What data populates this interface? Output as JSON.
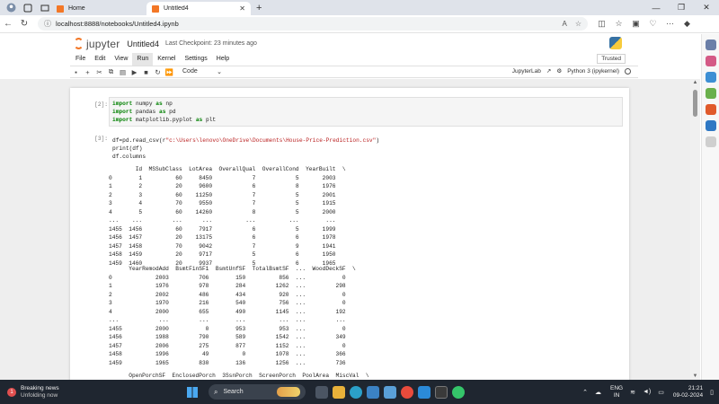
{
  "browser": {
    "tabs": [
      {
        "label": "Home",
        "active": false,
        "icon": "jupyter-favicon"
      },
      {
        "label": "Untitled4",
        "active": true,
        "icon": "jupyter-favicon"
      }
    ],
    "url": "localhost:8888/notebooks/Untitled4.ipynb"
  },
  "jupyter": {
    "logo_text": "jupyter",
    "notebook_name": "Untitled4",
    "checkpoint": "Last Checkpoint: 23 minutes ago",
    "menu": [
      "File",
      "Edit",
      "View",
      "Run",
      "Kernel",
      "Settings",
      "Help"
    ],
    "selected_menu": "Run",
    "trusted": "Trusted",
    "cell_type": "Code",
    "jupyterlab_link": "JupyterLab",
    "kernel": "Python 3 (ipykernel)"
  },
  "cells": [
    {
      "prompt": "[2]:",
      "code_lines": [
        {
          "kw": "import",
          "rest": " numpy ",
          "kw2": "as",
          "rest2": " np"
        },
        {
          "kw": "import",
          "rest": " pandas ",
          "kw2": "as",
          "rest2": " pd"
        },
        {
          "kw": "import",
          "rest": " matplotlib.pyplot ",
          "kw2": "as",
          "rest2": " plt"
        }
      ]
    },
    {
      "prompt": "[3]:",
      "code_line1_pre": "df=pd.read_csv(r",
      "code_line1_str": "\"c:\\Users\\lenovo\\OneDrive\\Documents\\House-Price-Prediction.csv\"",
      "code_line1_post": ")",
      "code_line2": "print(df)",
      "code_line3": "df.columns",
      "output_blocks": [
        "        Id  MSSubClass  LotArea  OverallQual  OverallCond  YearBuilt  \\\n0        1          60     8450            7            5       2003   \n1        2          20     9600            6            8       1976   \n2        3          60    11250            7            5       2001   \n3        4          70     9550            7            5       1915   \n4        5          60    14260            8            5       2000   \n...    ...         ...      ...          ...          ...        ...   \n1455  1456          60     7917            6            5       1999   \n1456  1457          20    13175            6            6       1978   \n1457  1458          70     9042            7            9       1941   \n1458  1459          20     9717            5            6       1950   \n1459  1460          20     9937            5            6       1965   ",
        "      YearRemodAdd  BsmtFinSF1  BsmtUnfSF  TotalBsmtSF  ...  WoodDeckSF  \\\n0             2003         706        150          856  ...           0   \n1             1976         978        284         1262  ...         298   \n2             2002         486        434          920  ...           0   \n3             1970         216        540          756  ...           0   \n4             2000         655        490         1145  ...         192   \n...            ...         ...        ...          ...  ...         ...   \n1455          2000           0        953          953  ...           0   \n1456          1988         790        589         1542  ...         349   \n1457          2006         275        877         1152  ...           0   \n1458          1996          49          0         1078  ...         366   \n1459          1965         830        136         1256  ...         736   ",
        "      OpenPorchSF  EnclosedPorch  3SsnPorch  ScreenPorch  PoolArea  MiscVal  \\"
      ]
    }
  ],
  "taskbar": {
    "news_badge": "1",
    "news_title": "Breaking news",
    "news_sub": "Unfolding now",
    "search_placeholder": "Search",
    "lang_top": "ENG",
    "lang_bottom": "IN",
    "time": "21:21",
    "date": "09-02-2024"
  },
  "colors": {
    "jupyter_orange": "#f37726",
    "keyword_green": "#008000",
    "string_red": "#ba2121",
    "taskbar": "#1f2630"
  }
}
